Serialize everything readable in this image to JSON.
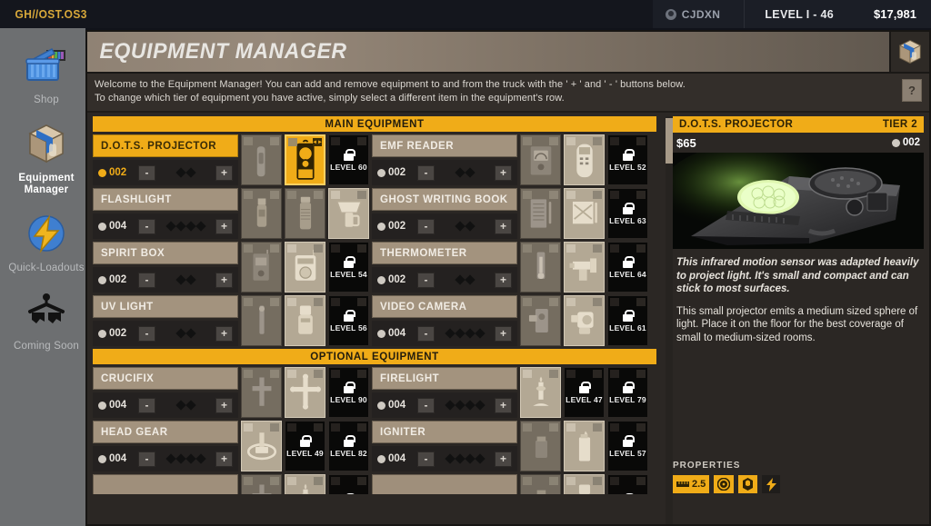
{
  "topbar": {
    "brand": "GH//OST.OS3",
    "player_name": "CJDXN",
    "level": "LEVEL I - 46",
    "money": "$17,981"
  },
  "sidebar": {
    "items": [
      {
        "label": "Shop",
        "icon": "basket-icon",
        "active": false
      },
      {
        "label": "Equipment\nManager",
        "label_line1": "Equipment",
        "label_line2": "Manager",
        "icon": "equipment-box-icon",
        "active": true
      },
      {
        "label": "Quick-Loadouts",
        "icon": "lightning-icon",
        "active": false
      },
      {
        "label": "Coming Soon",
        "icon": "hanger-icon",
        "active": false
      }
    ]
  },
  "panel": {
    "title": "EQUIPMENT MANAGER",
    "header_icon": "equipment-box-icon",
    "intro_line1": "Welcome to the Equipment Manager! You can add and remove equipment to and from the truck with the ' + ' and ' - ' buttons below.",
    "intro_line2": "To change which tier of equipment you have active, simply select a different item in the equipment's row.",
    "help_label": "?"
  },
  "sections": [
    {
      "header": "MAIN EQUIPMENT",
      "rows": [
        {
          "left": {
            "name": "D.O.T.S. PROJECTOR",
            "count": "002",
            "diamonds": 2,
            "selected": true,
            "minus": "-",
            "plus": "+",
            "slots": [
              {
                "state": "dim",
                "icon": "dots-t1"
              },
              {
                "state": "selected",
                "icon": "dots-t2"
              },
              {
                "state": "locked",
                "level": "LEVEL 60"
              }
            ]
          },
          "right": {
            "name": "EMF READER",
            "count": "002",
            "diamonds": 2,
            "selected": false,
            "minus": "-",
            "plus": "+",
            "slots": [
              {
                "state": "dim",
                "icon": "emf-t1"
              },
              {
                "state": "owned",
                "icon": "emf-t2"
              },
              {
                "state": "locked",
                "level": "LEVEL 52"
              }
            ]
          }
        },
        {
          "left": {
            "name": "FLASHLIGHT",
            "count": "004",
            "diamonds": 4,
            "selected": false,
            "minus": "-",
            "plus": "+",
            "slots": [
              {
                "state": "dim",
                "icon": "flash-t1"
              },
              {
                "state": "dim",
                "icon": "flash-t2"
              },
              {
                "state": "owned",
                "icon": "flash-t3"
              }
            ]
          },
          "right": {
            "name": "GHOST WRITING BOOK",
            "count": "002",
            "diamonds": 2,
            "selected": false,
            "minus": "-",
            "plus": "+",
            "slots": [
              {
                "state": "dim",
                "icon": "book-t1"
              },
              {
                "state": "owned",
                "icon": "book-t2"
              },
              {
                "state": "locked",
                "level": "LEVEL 63"
              }
            ]
          }
        },
        {
          "left": {
            "name": "SPIRIT BOX",
            "count": "002",
            "diamonds": 2,
            "selected": false,
            "minus": "-",
            "plus": "+",
            "slots": [
              {
                "state": "dim",
                "icon": "spirit-t1"
              },
              {
                "state": "owned",
                "icon": "spirit-t2"
              },
              {
                "state": "locked",
                "level": "LEVEL 54"
              }
            ]
          },
          "right": {
            "name": "THERMOMETER",
            "count": "002",
            "diamonds": 2,
            "selected": false,
            "minus": "-",
            "plus": "+",
            "slots": [
              {
                "state": "dim",
                "icon": "thermo-t1"
              },
              {
                "state": "owned",
                "icon": "thermo-t2"
              },
              {
                "state": "locked",
                "level": "LEVEL 64"
              }
            ]
          }
        },
        {
          "left": {
            "name": "UV LIGHT",
            "count": "002",
            "diamonds": 2,
            "selected": false,
            "minus": "-",
            "plus": "+",
            "slots": [
              {
                "state": "dim",
                "icon": "uv-t1"
              },
              {
                "state": "owned",
                "icon": "uv-t2"
              },
              {
                "state": "locked",
                "level": "LEVEL 56"
              }
            ]
          },
          "right": {
            "name": "VIDEO CAMERA",
            "count": "004",
            "diamonds": 4,
            "selected": false,
            "minus": "-",
            "plus": "+",
            "slots": [
              {
                "state": "dim",
                "icon": "cam-t1"
              },
              {
                "state": "owned",
                "icon": "cam-t2"
              },
              {
                "state": "locked",
                "level": "LEVEL 61"
              }
            ]
          }
        }
      ]
    },
    {
      "header": "OPTIONAL EQUIPMENT",
      "rows": [
        {
          "left": {
            "name": "CRUCIFIX",
            "count": "004",
            "diamonds": 2,
            "selected": false,
            "minus": "-",
            "plus": "+",
            "slots": [
              {
                "state": "dim",
                "icon": "cross-t1"
              },
              {
                "state": "owned",
                "icon": "cross-t2"
              },
              {
                "state": "locked",
                "level": "LEVEL 90"
              }
            ]
          },
          "right": {
            "name": "FIRELIGHT",
            "count": "004",
            "diamonds": 4,
            "selected": false,
            "minus": "-",
            "plus": "+",
            "slots": [
              {
                "state": "owned",
                "icon": "candle-t1"
              },
              {
                "state": "locked",
                "level": "LEVEL 47"
              },
              {
                "state": "locked",
                "level": "LEVEL 79"
              }
            ]
          }
        },
        {
          "left": {
            "name": "HEAD GEAR",
            "count": "004",
            "diamonds": 4,
            "selected": false,
            "minus": "-",
            "plus": "+",
            "slots": [
              {
                "state": "owned",
                "icon": "head-t1"
              },
              {
                "state": "locked",
                "level": "LEVEL 49"
              },
              {
                "state": "locked",
                "level": "LEVEL 82"
              }
            ]
          },
          "right": {
            "name": "IGNITER",
            "count": "004",
            "diamonds": 4,
            "selected": false,
            "minus": "-",
            "plus": "+",
            "slots": [
              {
                "state": "dim",
                "icon": "lighter-t1"
              },
              {
                "state": "owned",
                "icon": "lighter-t2"
              },
              {
                "state": "locked",
                "level": "LEVEL 57"
              }
            ]
          }
        }
      ]
    }
  ],
  "detail": {
    "name": "D.O.T.S. PROJECTOR",
    "tier": "TIER 2",
    "price": "$65",
    "owned": "002",
    "image_alt": "dots-projector-photo",
    "desc1": "This infrared motion sensor was adapted heavily to project light. It's small and compact and can stick to most surfaces.",
    "desc2": "This small projector emits a medium sized sphere of light. Place it on the floor for the best coverage of small to medium-sized rooms.",
    "properties_label": "PROPERTIES",
    "properties": [
      {
        "icon": "ruler-icon",
        "value": "2.5",
        "style": "light"
      },
      {
        "icon": "disc-icon",
        "value": "",
        "style": "light"
      },
      {
        "icon": "box-icon",
        "value": "",
        "style": "light"
      },
      {
        "icon": "lightning-icon",
        "value": "",
        "style": "dark"
      }
    ]
  },
  "colors": {
    "accent": "#f0ac18",
    "panel_bg": "#2b2724",
    "title_bar": "#a3937e",
    "locked": "#090908"
  }
}
